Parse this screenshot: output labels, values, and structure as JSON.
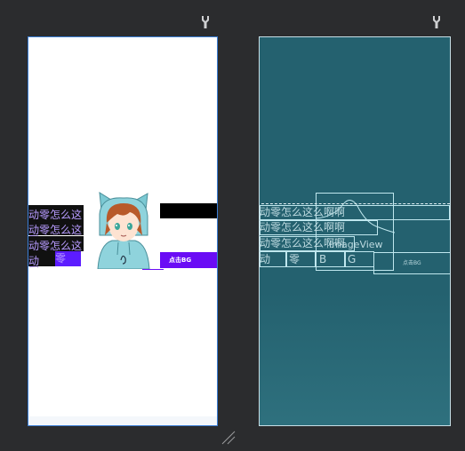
{
  "colors": {
    "workspace_bg": "#2b2c2e",
    "design_bg": "#ffffff",
    "design_border": "#3b7fd6",
    "blueprint_bg": "#24616f",
    "blueprint_line": "#bfe7ee",
    "text_purple": "#b79bff",
    "accent_purple": "#6a0cf5"
  },
  "design": {
    "text_rows": [
      "动零怎么这么",
      "动零怎么这么",
      "动零怎么这么"
    ],
    "last_row": {
      "char1": "动",
      "char2": "零"
    },
    "button_label": "点击BG"
  },
  "blueprint": {
    "text_rows": [
      "动零怎么这么啊啊",
      "动零怎么这么啊啊",
      "动零怎么这么啊啊"
    ],
    "last_row": {
      "char1": "动",
      "char2": "零",
      "char3": "B",
      "char4": "G"
    },
    "imageview_label": "ImageView",
    "button_label": "点击BG"
  },
  "icons": {
    "design_toolbar": "wrench-icon",
    "blueprint_toolbar": "wrench-icon",
    "resize": "resize-handle-icon"
  }
}
